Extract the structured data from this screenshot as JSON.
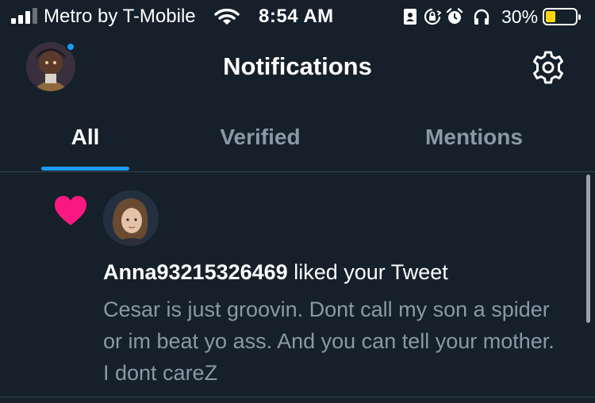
{
  "status_bar": {
    "carrier": "Metro by T-Mobile",
    "time": "8:54 AM",
    "battery_percent": "30%",
    "battery_level": 0.3,
    "icons": [
      "signal-icon",
      "wifi-icon",
      "contact-card-icon",
      "rotation-lock-icon",
      "alarm-icon",
      "headphones-icon",
      "battery-icon"
    ]
  },
  "header": {
    "title": "Notifications",
    "avatar_has_notification_dot": true
  },
  "tabs": [
    {
      "label": "All",
      "active": true
    },
    {
      "label": "Verified",
      "active": false
    },
    {
      "label": "Mentions",
      "active": false
    }
  ],
  "notification": {
    "type_icon": "heart-icon",
    "username": "Anna93215326469",
    "action": "liked your Tweet",
    "tweet_text": "Cesar is just groovin. Dont call my son a spider or im beat yo ass. And you can tell your mother. I dont careZ"
  },
  "colors": {
    "background": "#15202b",
    "accent": "#1d9bf0",
    "heart": "#f91880",
    "secondary_text": "#8b98a5",
    "battery_fill": "#ffd60a"
  }
}
